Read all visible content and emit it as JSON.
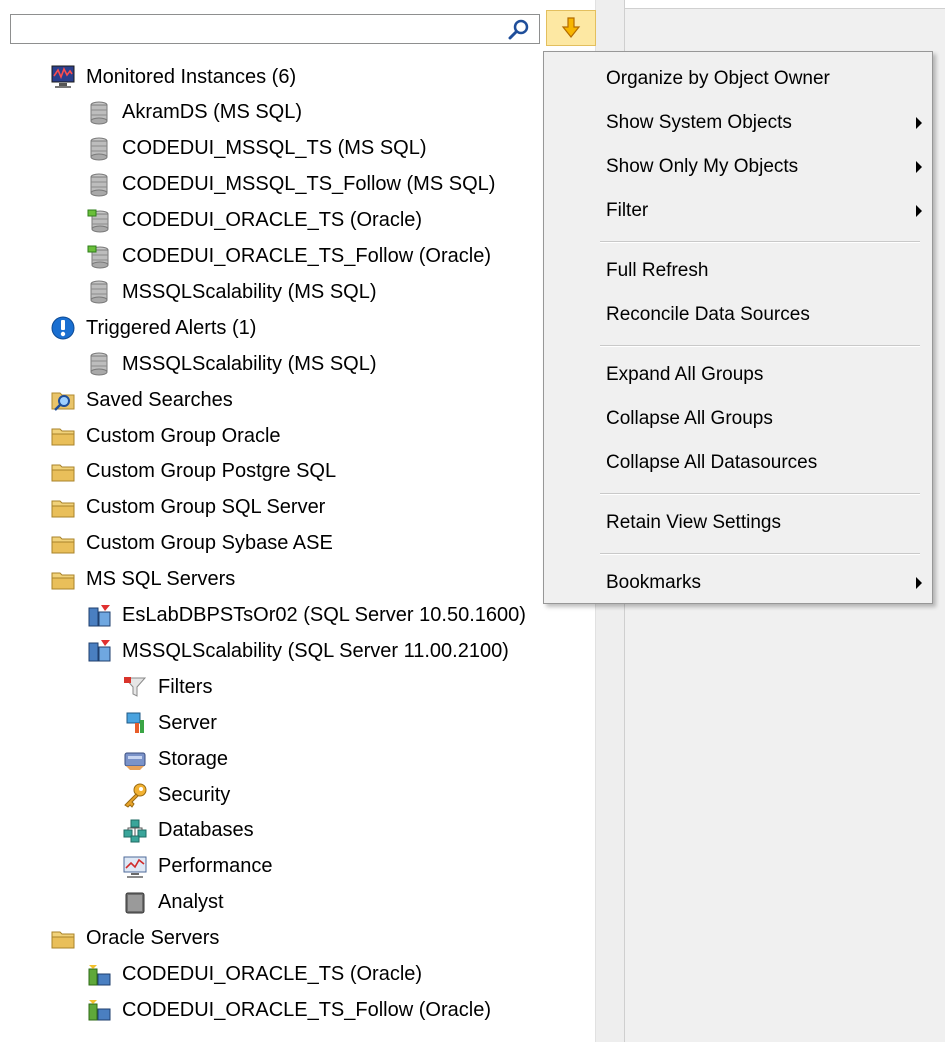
{
  "search": {
    "value": "",
    "placeholder": ""
  },
  "icons": {
    "search": "magnifier-icon",
    "dropdown": "down-arrow-icon"
  },
  "tree": [
    {
      "label": "Monitored Instances (6)",
      "icon": "monitor-icon"
    },
    {
      "label": "AkramDS (MS SQL)",
      "icon": "database-icon"
    },
    {
      "label": "CODEDUI_MSSQL_TS (MS SQL)",
      "icon": "database-icon"
    },
    {
      "label": "CODEDUI_MSSQL_TS_Follow (MS SQL)",
      "icon": "database-icon"
    },
    {
      "label": "CODEDUI_ORACLE_TS (Oracle)",
      "icon": "database-oracle-icon"
    },
    {
      "label": "CODEDUI_ORACLE_TS_Follow (Oracle)",
      "icon": "database-oracle-icon"
    },
    {
      "label": "MSSQLScalability (MS SQL)",
      "icon": "database-icon"
    },
    {
      "label": "Triggered Alerts (1)",
      "icon": "alert-icon"
    },
    {
      "label": "MSSQLScalability (MS SQL)",
      "icon": "database-icon"
    },
    {
      "label": "Saved Searches",
      "icon": "saved-search-folder-icon"
    },
    {
      "label": "Custom Group Oracle",
      "icon": "folder-icon"
    },
    {
      "label": "Custom Group Postgre SQL",
      "icon": "folder-icon"
    },
    {
      "label": "Custom Group SQL Server",
      "icon": "folder-icon"
    },
    {
      "label": "Custom Group Sybase ASE",
      "icon": "folder-icon"
    },
    {
      "label": "MS SQL Servers",
      "icon": "folder-icon"
    },
    {
      "label": "EsLabDBPSTsOr02 (SQL Server 10.50.1600)",
      "icon": "sql-server-icon"
    },
    {
      "label": "MSSQLScalability (SQL Server 11.00.2100)",
      "icon": "sql-server-icon"
    },
    {
      "label": "Filters",
      "icon": "filter-icon"
    },
    {
      "label": "Server",
      "icon": "server-icon"
    },
    {
      "label": "Storage",
      "icon": "storage-icon"
    },
    {
      "label": "Security",
      "icon": "key-icon"
    },
    {
      "label": "Databases",
      "icon": "databases-icon"
    },
    {
      "label": "Performance",
      "icon": "performance-icon"
    },
    {
      "label": "Analyst",
      "icon": "analyst-icon"
    },
    {
      "label": "Oracle Servers",
      "icon": "folder-icon"
    },
    {
      "label": "CODEDUI_ORACLE_TS (Oracle)",
      "icon": "oracle-server-icon"
    },
    {
      "label": "CODEDUI_ORACLE_TS_Follow (Oracle)",
      "icon": "oracle-server-icon"
    }
  ],
  "menu": {
    "items": [
      {
        "label": "Organize by Object Owner",
        "submenu": false
      },
      {
        "label": "Show System Objects",
        "submenu": true
      },
      {
        "label": "Show Only My Objects",
        "submenu": true
      },
      {
        "label": "Filter",
        "submenu": true
      },
      {
        "label": "Full Refresh",
        "submenu": false
      },
      {
        "label": "Reconcile Data Sources",
        "submenu": false
      },
      {
        "label": "Expand All Groups",
        "submenu": false
      },
      {
        "label": "Collapse All Groups",
        "submenu": false
      },
      {
        "label": "Collapse All Datasources",
        "submenu": false
      },
      {
        "label": "Retain View Settings",
        "submenu": false
      },
      {
        "label": "Bookmarks",
        "submenu": true
      }
    ]
  },
  "colors": {
    "menu_bg": "#f0f0f0",
    "dropdown_button_bg": "#fde8a3",
    "folder": "#e9c46a",
    "alert": "#1a6fd1"
  }
}
